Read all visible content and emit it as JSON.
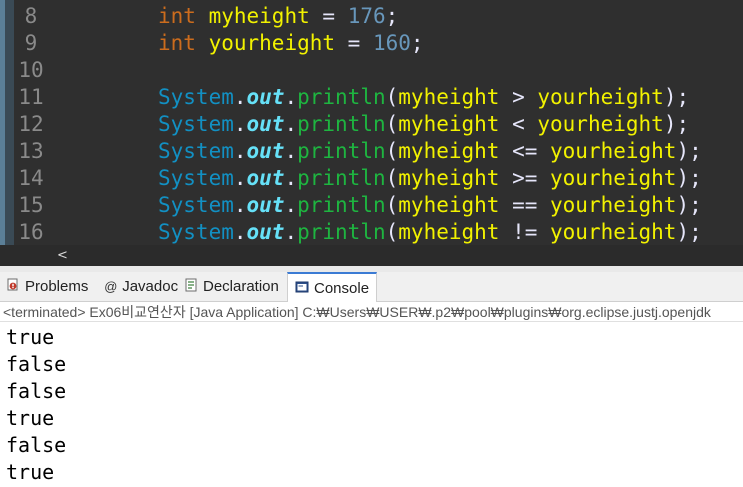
{
  "editor": {
    "lines": [
      {
        "num": "8",
        "tokens": [
          {
            "t": "int",
            "c": "kw"
          },
          {
            "t": " ",
            "c": "plain"
          },
          {
            "t": "myheight",
            "c": "var"
          },
          {
            "t": " = ",
            "c": "op"
          },
          {
            "t": "176",
            "c": "num"
          },
          {
            "t": ";",
            "c": "op"
          }
        ]
      },
      {
        "num": "9",
        "tokens": [
          {
            "t": "int",
            "c": "kw"
          },
          {
            "t": " ",
            "c": "plain"
          },
          {
            "t": "yourheight",
            "c": "var"
          },
          {
            "t": " = ",
            "c": "op"
          },
          {
            "t": "160",
            "c": "num"
          },
          {
            "t": ";",
            "c": "op"
          }
        ]
      },
      {
        "num": "10",
        "tokens": []
      },
      {
        "num": "11",
        "tokens": [
          {
            "t": "System",
            "c": "cls"
          },
          {
            "t": ".",
            "c": "op"
          },
          {
            "t": "out",
            "c": "fld"
          },
          {
            "t": ".",
            "c": "op"
          },
          {
            "t": "println",
            "c": "mth"
          },
          {
            "t": "(",
            "c": "op"
          },
          {
            "t": "myheight",
            "c": "var"
          },
          {
            "t": " > ",
            "c": "op"
          },
          {
            "t": "yourheight",
            "c": "var"
          },
          {
            "t": ");",
            "c": "op"
          }
        ]
      },
      {
        "num": "12",
        "tokens": [
          {
            "t": "System",
            "c": "cls"
          },
          {
            "t": ".",
            "c": "op"
          },
          {
            "t": "out",
            "c": "fld"
          },
          {
            "t": ".",
            "c": "op"
          },
          {
            "t": "println",
            "c": "mth"
          },
          {
            "t": "(",
            "c": "op"
          },
          {
            "t": "myheight",
            "c": "var"
          },
          {
            "t": " < ",
            "c": "op"
          },
          {
            "t": "yourheight",
            "c": "var"
          },
          {
            "t": ");",
            "c": "op"
          }
        ]
      },
      {
        "num": "13",
        "tokens": [
          {
            "t": "System",
            "c": "cls"
          },
          {
            "t": ".",
            "c": "op"
          },
          {
            "t": "out",
            "c": "fld"
          },
          {
            "t": ".",
            "c": "op"
          },
          {
            "t": "println",
            "c": "mth"
          },
          {
            "t": "(",
            "c": "op"
          },
          {
            "t": "myheight",
            "c": "var"
          },
          {
            "t": " <= ",
            "c": "op"
          },
          {
            "t": "yourheight",
            "c": "var"
          },
          {
            "t": ");",
            "c": "op"
          }
        ]
      },
      {
        "num": "14",
        "tokens": [
          {
            "t": "System",
            "c": "cls"
          },
          {
            "t": ".",
            "c": "op"
          },
          {
            "t": "out",
            "c": "fld"
          },
          {
            "t": ".",
            "c": "op"
          },
          {
            "t": "println",
            "c": "mth"
          },
          {
            "t": "(",
            "c": "op"
          },
          {
            "t": "myheight",
            "c": "var"
          },
          {
            "t": " >= ",
            "c": "op"
          },
          {
            "t": "yourheight",
            "c": "var"
          },
          {
            "t": ");",
            "c": "op"
          }
        ]
      },
      {
        "num": "15",
        "tokens": [
          {
            "t": "System",
            "c": "cls"
          },
          {
            "t": ".",
            "c": "op"
          },
          {
            "t": "out",
            "c": "fld"
          },
          {
            "t": ".",
            "c": "op"
          },
          {
            "t": "println",
            "c": "mth"
          },
          {
            "t": "(",
            "c": "op"
          },
          {
            "t": "myheight",
            "c": "var"
          },
          {
            "t": " == ",
            "c": "op"
          },
          {
            "t": "yourheight",
            "c": "var"
          },
          {
            "t": ");",
            "c": "op"
          }
        ]
      },
      {
        "num": "16",
        "tokens": [
          {
            "t": "System",
            "c": "cls"
          },
          {
            "t": ".",
            "c": "op"
          },
          {
            "t": "out",
            "c": "fld"
          },
          {
            "t": ".",
            "c": "op"
          },
          {
            "t": "println",
            "c": "mth"
          },
          {
            "t": "(",
            "c": "op"
          },
          {
            "t": "myheight",
            "c": "var"
          },
          {
            "t": " != ",
            "c": "op"
          },
          {
            "t": "yourheight",
            "c": "var"
          },
          {
            "t": ");",
            "c": "op"
          }
        ]
      }
    ],
    "scroll_left_glyph": "<"
  },
  "tabs": {
    "problems": {
      "label": "Problems",
      "icon": "problems-icon",
      "icon_color": "#c0392b"
    },
    "javadoc": {
      "label": "Javadoc",
      "icon": "at-icon",
      "glyph": "@"
    },
    "declaration": {
      "label": "Declaration",
      "icon": "declaration-icon"
    },
    "console": {
      "label": "Console",
      "icon": "console-icon",
      "active": true
    }
  },
  "status": {
    "text": "<terminated> Ex06비교연산자 [Java Application] C:₩Users₩USER₩.p2₩pool₩plugins₩org.eclipse.justj.openjdk"
  },
  "console": {
    "output": [
      "true",
      "false",
      "false",
      "true",
      "false",
      "true"
    ]
  },
  "colors": {
    "editor_bg": "#2f2f2f",
    "keyword": "#cc6c1d",
    "variable": "#f2f200",
    "number": "#6897bb",
    "class": "#1290c3",
    "field": "#66e1f8",
    "method": "#1eb540",
    "active_tab_accent": "#3b7bd4"
  }
}
